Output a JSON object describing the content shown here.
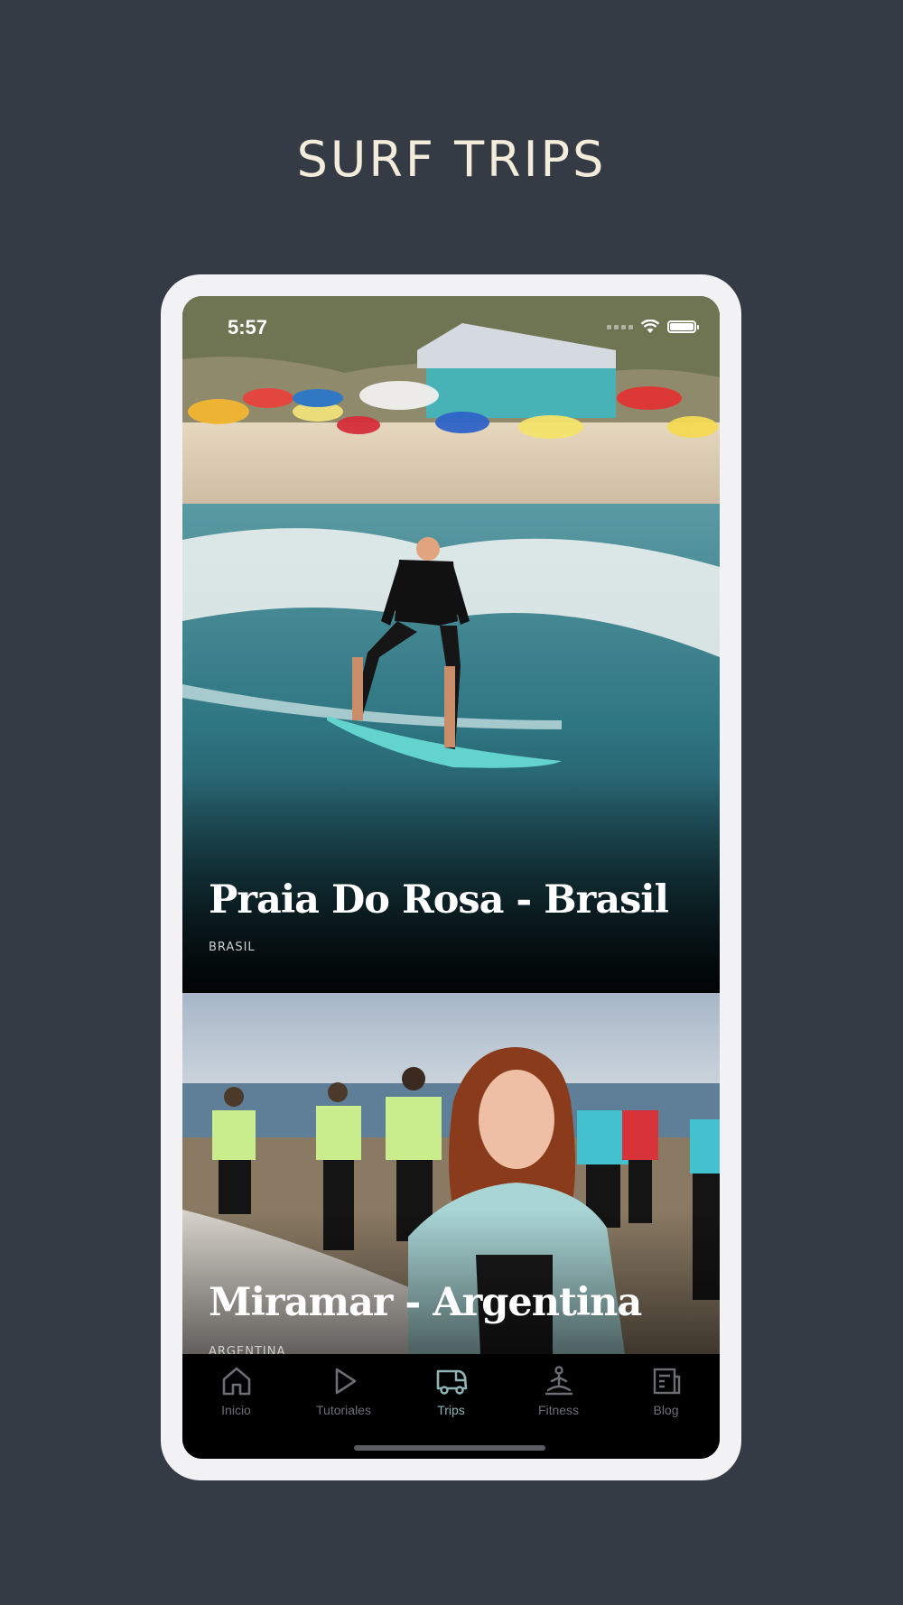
{
  "page": {
    "headline": "SURF TRIPS"
  },
  "status_bar": {
    "time": "5:57"
  },
  "trips": [
    {
      "title": "Praia Do Rosa - Brasil",
      "country": "BRASIL"
    },
    {
      "title": "Miramar - Argentina",
      "country": "ARGENTINA"
    }
  ],
  "tab_bar": {
    "items": [
      {
        "label": "Inicio",
        "icon": "home-icon"
      },
      {
        "label": "Tutoriales",
        "icon": "play-icon"
      },
      {
        "label": "Trips",
        "icon": "van-icon",
        "active": true
      },
      {
        "label": "Fitness",
        "icon": "meditation-icon"
      },
      {
        "label": "Blog",
        "icon": "news-icon"
      }
    ]
  },
  "colors": {
    "background": "#353b45",
    "headline": "#f3ecdb",
    "active_tab": "#8fb5b6",
    "inactive_tab": "#6b6f74"
  }
}
